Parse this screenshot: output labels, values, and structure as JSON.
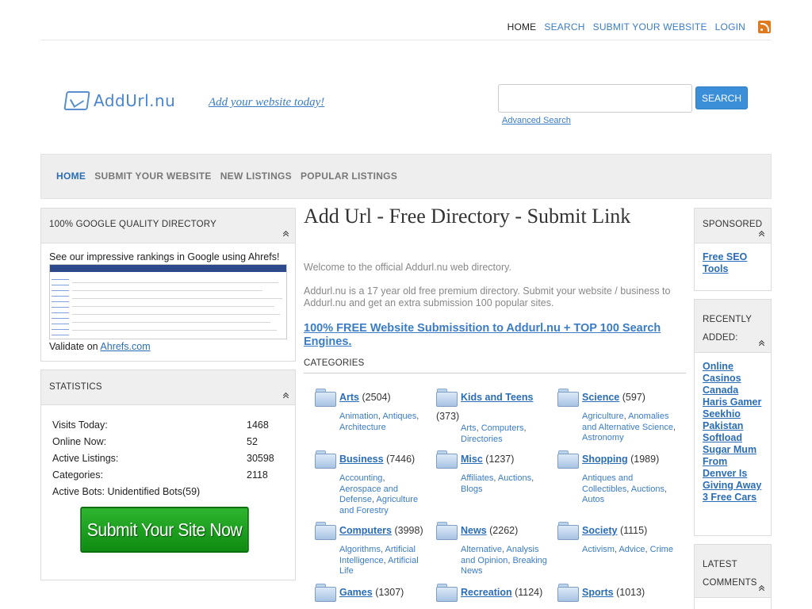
{
  "topnav": {
    "items": [
      {
        "label": "HOME"
      },
      {
        "label": "SEARCH"
      },
      {
        "label": "SUBMIT YOUR WEBSITE"
      },
      {
        "label": "LOGIN"
      }
    ],
    "rss_icon": "rss-icon"
  },
  "header": {
    "logo_text": "AddUrl.nu",
    "tagline": "Add your website today!",
    "search_placeholder": "",
    "search_button": "SEARCH",
    "advanced_search": "Advanced Search"
  },
  "mainnav": {
    "items": [
      {
        "label": "HOME"
      },
      {
        "label": "SUBMIT YOUR WEBSITE"
      },
      {
        "label": "NEW LISTINGS"
      },
      {
        "label": "POPULAR LISTINGS"
      }
    ]
  },
  "left": {
    "google_box": {
      "title": "100% GOOGLE QUALITY DIRECTORY",
      "text": "See our impressive rankings in Google using Ahrefs!",
      "validate_prefix": "Validate on ",
      "validate_link": "Ahrefs.com"
    },
    "stats_box": {
      "title": "STATISTICS",
      "rows": [
        {
          "label": "Visits Today:",
          "value": "1468"
        },
        {
          "label": "Online Now:",
          "value": "52"
        },
        {
          "label": "Active Listings:",
          "value": "30598"
        },
        {
          "label": "Categories:",
          "value": "2118"
        }
      ],
      "bots": "Active Bots: Unidentified Bots(59)",
      "banner": "Submit Your Site Now"
    }
  },
  "main": {
    "title": "Add Url - Free Directory - Submit Link",
    "welcome": "Welcome to the official Addurl.nu web directory.",
    "intro": "Addurl.nu is a 17 year old free premium directory. Submit your website / business to Addurl.nu and get an extra submission 100 popular sites.",
    "free_link": "100% FREE Website Submissition to Addurl.nu + TOP 100 Search Engines.",
    "categories_heading": "CATEGORIES",
    "categories": [
      {
        "name": "Arts",
        "count": "(2504)",
        "subs": [
          "Animation",
          "Antiques",
          "Architecture"
        ]
      },
      {
        "name": "Kids and Teens",
        "count": "(373)",
        "subs": [
          "Arts",
          "Computers",
          "Directories"
        ]
      },
      {
        "name": "Science",
        "count": "(597)",
        "subs": [
          "Agriculture",
          "Anomalies and Alternative Science",
          "Astronomy"
        ]
      },
      {
        "name": "Business",
        "count": "(7446)",
        "subs": [
          "Accounting",
          "Aerospace and Defense",
          "Agriculture and Forestry"
        ]
      },
      {
        "name": "Misc",
        "count": "(1237)",
        "subs": [
          "Affiliates",
          "Auctions",
          "Blogs"
        ]
      },
      {
        "name": "Shopping",
        "count": "(1989)",
        "subs": [
          "Antiques and Collectibles",
          "Auctions",
          "Autos"
        ]
      },
      {
        "name": "Computers",
        "count": "(3998)",
        "subs": [
          "Algorithms",
          "Artificial Intelligence",
          "Artificial Life"
        ]
      },
      {
        "name": "News",
        "count": "(2262)",
        "subs": [
          "Alternative",
          "Analysis and Opinion",
          "Breaking News"
        ]
      },
      {
        "name": "Society",
        "count": "(1115)",
        "subs": [
          "Activism",
          "Advice",
          "Crime"
        ]
      },
      {
        "name": "Games",
        "count": "(1307)",
        "subs": []
      },
      {
        "name": "Recreation",
        "count": "(1124)",
        "subs": []
      },
      {
        "name": "Sports",
        "count": "(1013)",
        "subs": []
      }
    ]
  },
  "right": {
    "sponsored": {
      "title": "SPONSORED",
      "links": [
        "Free SEO Tools"
      ]
    },
    "recent": {
      "title": "RECENTLY ADDED:",
      "links": [
        "Online Casinos Canada",
        "Haris Gamer",
        "Seekhio Pakistan",
        "Softload",
        "Sugar Mum From Denver Is Giving Away 3 Free Cars"
      ]
    },
    "comments": {
      "title": "LATEST COMMENTS"
    }
  }
}
